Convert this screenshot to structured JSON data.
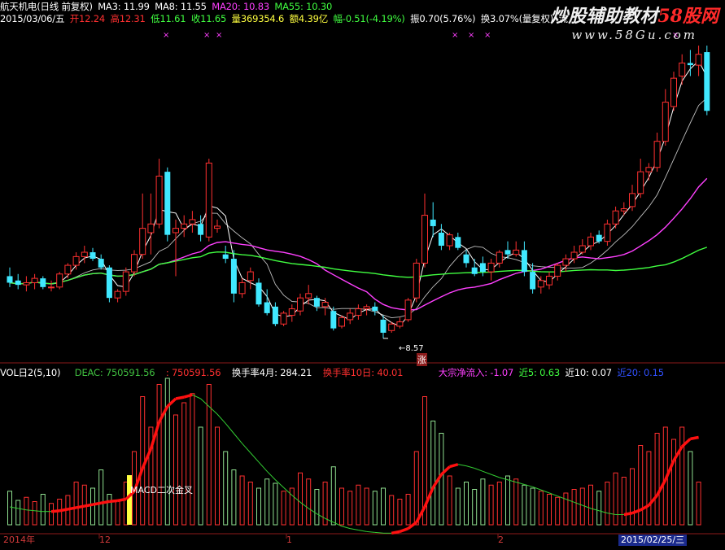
{
  "header": {
    "stock_name": "航天机电(日线 前复权)",
    "ma3": "MA3: 11.99",
    "ma8": "MA8: 11.55",
    "ma20": "MA20: 10.83",
    "ma55": "MA55: 10.30",
    "date": "2015/03/06/五",
    "open": "开12.24",
    "high": "高12.31",
    "low": "低11.61",
    "close": "收11.65",
    "volume": "量369354.6",
    "amount": "额4.39亿",
    "change": "幅-0.51(-4.19%)",
    "amplitude": "振0.70(5.76%)",
    "turnover": "换3.07%(量复权)",
    "extra": "流"
  },
  "watermark": {
    "title_white": "炒股辅助教材",
    "title_red": "58股网",
    "url": "www.58Gu.com"
  },
  "volume_header": {
    "indicator": "VOL日2(5,10)",
    "deac": "DEAC: 750591.56",
    "dea": ": 750591.56",
    "turnover_4m": "换手率4月: 284.21",
    "turnover_10d": "换手率10日: 40.01",
    "big_flow": "大宗净流入: -1.07",
    "near5": "近5: 0.63",
    "near10": "近10: 0.07",
    "near20": "近20: 0.15"
  },
  "annotations": {
    "low_marker": "8.57",
    "zhang": "涨",
    "macd_text": "MACD二次金叉"
  },
  "time_axis": {
    "labels": [
      "2014年",
      "12",
      "1",
      "2"
    ],
    "current_date": "2015/02/25/三"
  },
  "colors": {
    "up": "#ff3030",
    "down": "#40e8ff",
    "ma3": "#ffffff",
    "ma8": "#ffffff",
    "ma20": "#ff40ff",
    "ma55": "#40ff40",
    "macd_red": "#ff1010",
    "macd_green": "#33cc33"
  },
  "chart_data": {
    "type": "candlestick",
    "lowest_price": 8.57,
    "candles": [
      {
        "o": 10.0,
        "h": 10.2,
        "l": 9.75,
        "c": 9.85
      },
      {
        "o": 9.9,
        "h": 10.05,
        "l": 9.7,
        "c": 9.8
      },
      {
        "o": 9.8,
        "h": 10.0,
        "l": 9.65,
        "c": 9.85
      },
      {
        "o": 9.85,
        "h": 10.05,
        "l": 9.7,
        "c": 9.95
      },
      {
        "o": 9.95,
        "h": 10.0,
        "l": 9.7,
        "c": 9.75
      },
      {
        "o": 9.75,
        "h": 9.9,
        "l": 9.65,
        "c": 9.75
      },
      {
        "o": 9.75,
        "h": 10.1,
        "l": 9.7,
        "c": 10.05
      },
      {
        "o": 10.05,
        "h": 10.3,
        "l": 9.95,
        "c": 10.25
      },
      {
        "o": 10.25,
        "h": 10.55,
        "l": 10.15,
        "c": 10.45
      },
      {
        "o": 10.45,
        "h": 10.7,
        "l": 10.3,
        "c": 10.55
      },
      {
        "o": 10.55,
        "h": 10.65,
        "l": 10.35,
        "c": 10.4
      },
      {
        "o": 10.4,
        "h": 10.5,
        "l": 10.15,
        "c": 10.2
      },
      {
        "o": 10.2,
        "h": 10.25,
        "l": 9.4,
        "c": 9.5
      },
      {
        "o": 9.5,
        "h": 9.7,
        "l": 9.4,
        "c": 9.65
      },
      {
        "o": 9.65,
        "h": 10.2,
        "l": 9.55,
        "c": 10.1
      },
      {
        "o": 10.1,
        "h": 10.6,
        "l": 10.0,
        "c": 10.5
      },
      {
        "o": 10.5,
        "h": 11.9,
        "l": 10.4,
        "c": 11.1
      },
      {
        "o": 11.0,
        "h": 11.9,
        "l": 10.5,
        "c": 11.2
      },
      {
        "o": 11.2,
        "h": 12.7,
        "l": 11.1,
        "c": 12.3
      },
      {
        "o": 12.4,
        "h": 12.5,
        "l": 10.8,
        "c": 10.95
      },
      {
        "o": 11.0,
        "h": 11.3,
        "l": 10.0,
        "c": 11.1
      },
      {
        "o": 11.1,
        "h": 11.4,
        "l": 10.9,
        "c": 11.2
      },
      {
        "o": 11.2,
        "h": 11.5,
        "l": 11.0,
        "c": 11.3
      },
      {
        "o": 11.2,
        "h": 11.4,
        "l": 10.8,
        "c": 10.95
      },
      {
        "o": 10.9,
        "h": 12.7,
        "l": 10.8,
        "c": 12.6
      },
      {
        "o": 11.1,
        "h": 11.3,
        "l": 11.0,
        "c": 11.15
      },
      {
        "o": 10.5,
        "h": 10.7,
        "l": 10.3,
        "c": 10.4
      },
      {
        "o": 10.4,
        "h": 10.6,
        "l": 9.4,
        "c": 9.6
      },
      {
        "o": 9.6,
        "h": 9.95,
        "l": 9.5,
        "c": 9.85
      },
      {
        "o": 9.9,
        "h": 10.2,
        "l": 9.7,
        "c": 10.1
      },
      {
        "o": 9.85,
        "h": 9.95,
        "l": 9.3,
        "c": 9.35
      },
      {
        "o": 9.4,
        "h": 9.7,
        "l": 9.1,
        "c": 9.15
      },
      {
        "o": 9.3,
        "h": 9.4,
        "l": 8.85,
        "c": 8.9
      },
      {
        "o": 8.9,
        "h": 9.2,
        "l": 8.85,
        "c": 9.15
      },
      {
        "o": 9.1,
        "h": 9.35,
        "l": 8.95,
        "c": 9.25
      },
      {
        "o": 9.2,
        "h": 9.6,
        "l": 9.1,
        "c": 9.5
      },
      {
        "o": 9.5,
        "h": 9.8,
        "l": 9.35,
        "c": 9.6
      },
      {
        "o": 9.5,
        "h": 9.55,
        "l": 9.2,
        "c": 9.3
      },
      {
        "o": 9.3,
        "h": 9.5,
        "l": 9.1,
        "c": 9.4
      },
      {
        "o": 9.2,
        "h": 9.3,
        "l": 8.75,
        "c": 8.8
      },
      {
        "o": 8.85,
        "h": 9.1,
        "l": 8.8,
        "c": 9.05
      },
      {
        "o": 9.0,
        "h": 9.25,
        "l": 8.9,
        "c": 9.15
      },
      {
        "o": 9.1,
        "h": 9.35,
        "l": 9.0,
        "c": 9.25
      },
      {
        "o": 9.25,
        "h": 9.35,
        "l": 9.1,
        "c": 9.3
      },
      {
        "o": 9.3,
        "h": 9.4,
        "l": 9.1,
        "c": 9.2
      },
      {
        "o": 9.0,
        "h": 9.1,
        "l": 8.57,
        "c": 8.7
      },
      {
        "o": 8.75,
        "h": 8.95,
        "l": 8.7,
        "c": 8.9
      },
      {
        "o": 8.85,
        "h": 9.05,
        "l": 8.8,
        "c": 8.95
      },
      {
        "o": 9.0,
        "h": 9.5,
        "l": 8.95,
        "c": 9.45
      },
      {
        "o": 9.5,
        "h": 10.4,
        "l": 9.4,
        "c": 10.3
      },
      {
        "o": 10.3,
        "h": 11.9,
        "l": 10.2,
        "c": 11.4
      },
      {
        "o": 11.3,
        "h": 11.7,
        "l": 10.9,
        "c": 11.15
      },
      {
        "o": 11.0,
        "h": 11.2,
        "l": 10.6,
        "c": 10.7
      },
      {
        "o": 10.7,
        "h": 11.0,
        "l": 10.6,
        "c": 10.95
      },
      {
        "o": 10.9,
        "h": 11.0,
        "l": 10.6,
        "c": 10.65
      },
      {
        "o": 10.5,
        "h": 10.6,
        "l": 10.2,
        "c": 10.3
      },
      {
        "o": 10.2,
        "h": 10.4,
        "l": 10.0,
        "c": 10.05
      },
      {
        "o": 10.3,
        "h": 10.45,
        "l": 10.0,
        "c": 10.1
      },
      {
        "o": 10.1,
        "h": 10.4,
        "l": 9.9,
        "c": 10.3
      },
      {
        "o": 10.3,
        "h": 10.6,
        "l": 10.2,
        "c": 10.55
      },
      {
        "o": 10.6,
        "h": 10.8,
        "l": 10.4,
        "c": 10.5
      },
      {
        "o": 10.5,
        "h": 10.8,
        "l": 10.45,
        "c": 10.6
      },
      {
        "o": 10.6,
        "h": 10.8,
        "l": 10.0,
        "c": 10.1
      },
      {
        "o": 10.1,
        "h": 10.3,
        "l": 9.6,
        "c": 9.7
      },
      {
        "o": 9.75,
        "h": 10.0,
        "l": 9.6,
        "c": 9.9
      },
      {
        "o": 9.8,
        "h": 10.1,
        "l": 9.7,
        "c": 10.0
      },
      {
        "o": 10.0,
        "h": 10.3,
        "l": 9.9,
        "c": 10.25
      },
      {
        "o": 10.25,
        "h": 10.5,
        "l": 10.1,
        "c": 10.4
      },
      {
        "o": 10.4,
        "h": 10.7,
        "l": 10.3,
        "c": 10.55
      },
      {
        "o": 10.55,
        "h": 10.85,
        "l": 10.5,
        "c": 10.7
      },
      {
        "o": 10.7,
        "h": 11.0,
        "l": 10.6,
        "c": 10.9
      },
      {
        "o": 10.95,
        "h": 11.05,
        "l": 10.75,
        "c": 10.8
      },
      {
        "o": 10.8,
        "h": 11.3,
        "l": 10.7,
        "c": 11.2
      },
      {
        "o": 11.2,
        "h": 11.6,
        "l": 11.1,
        "c": 11.5
      },
      {
        "o": 11.5,
        "h": 11.7,
        "l": 11.4,
        "c": 11.55
      },
      {
        "o": 11.6,
        "h": 12.1,
        "l": 11.5,
        "c": 11.9
      },
      {
        "o": 11.9,
        "h": 12.7,
        "l": 11.8,
        "c": 12.4
      },
      {
        "o": 12.4,
        "h": 12.6,
        "l": 12.2,
        "c": 12.5
      },
      {
        "o": 12.5,
        "h": 13.3,
        "l": 12.4,
        "c": 13.1
      },
      {
        "o": 13.1,
        "h": 14.3,
        "l": 13.0,
        "c": 14.0
      },
      {
        "o": 13.9,
        "h": 14.7,
        "l": 13.8,
        "c": 14.55
      },
      {
        "o": 14.6,
        "h": 15.1,
        "l": 14.4,
        "c": 14.9
      },
      {
        "o": 14.9,
        "h": 15.2,
        "l": 14.6,
        "c": 14.85
      },
      {
        "o": 14.85,
        "h": 15.3,
        "l": 14.6,
        "c": 15.1
      },
      {
        "o": 15.15,
        "h": 15.3,
        "l": 13.7,
        "c": 13.8
      }
    ],
    "volumes": [
      55,
      40,
      45,
      38,
      50,
      35,
      42,
      48,
      70,
      65,
      60,
      90,
      50,
      40,
      70,
      120,
      210,
      160,
      230,
      240,
      180,
      200,
      215,
      160,
      230,
      160,
      120,
      90,
      80,
      70,
      60,
      75,
      68,
      55,
      60,
      85,
      75,
      58,
      70,
      95,
      60,
      55,
      65,
      60,
      55,
      60,
      48,
      42,
      50,
      120,
      210,
      170,
      150,
      80,
      60,
      70,
      58,
      75,
      65,
      70,
      80,
      75,
      65,
      60,
      55,
      50,
      45,
      52,
      58,
      60,
      65,
      55,
      70,
      85,
      78,
      92,
      130,
      120,
      150,
      160,
      140,
      160,
      120,
      70
    ],
    "macd": [
      20,
      18,
      16,
      15,
      14,
      14,
      15,
      17,
      19,
      21,
      23,
      25,
      27,
      28,
      30,
      40,
      70,
      95,
      130,
      150,
      160,
      162,
      165,
      160,
      150,
      140,
      128,
      115,
      102,
      90,
      78,
      66,
      55,
      45,
      35,
      26,
      18,
      11,
      5,
      0,
      -5,
      -8,
      -10,
      -12,
      -13,
      -14,
      -14,
      -12,
      -8,
      0,
      20,
      45,
      62,
      72,
      75,
      73,
      70,
      66,
      62,
      58,
      55,
      52,
      49,
      46,
      42,
      38,
      34,
      30,
      26,
      22,
      18,
      15,
      12,
      10,
      10,
      12,
      16,
      22,
      35,
      55,
      80,
      98,
      108,
      110
    ]
  }
}
